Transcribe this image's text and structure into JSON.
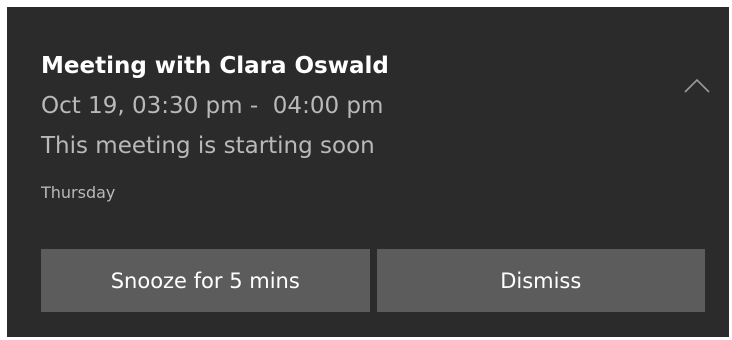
{
  "toast": {
    "title": "Meeting with Clara Oswald",
    "time": "Oct 19, 03:30 pm -  04:00 pm",
    "status": "This meeting is starting soon",
    "day": "Thursday",
    "collapse_icon": "chevron-up-icon",
    "colors": {
      "background": "#2b2b2b",
      "button": "#5c5c5c",
      "secondary_text": "#b9b9b9"
    }
  },
  "actions": {
    "snooze_label": "Snooze for 5 mins",
    "dismiss_label": "Dismiss"
  }
}
